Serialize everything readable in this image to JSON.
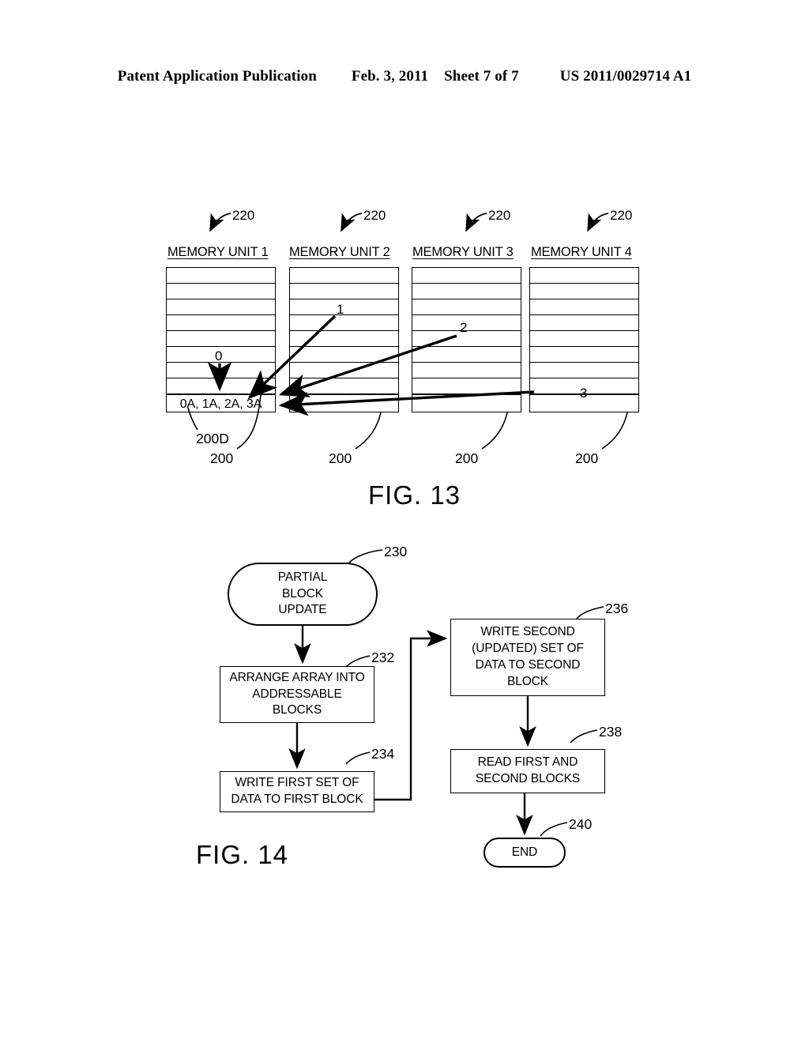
{
  "header": {
    "publication": "Patent Application Publication",
    "date": "Feb. 3, 2011",
    "sheet": "Sheet 7 of 7",
    "number": "US 2011/0029714 A1"
  },
  "figures": [
    {
      "caption": "FIG. 13",
      "unit_ref_label": "220",
      "block_ref_label": "200",
      "data_block_ref_label": "200D",
      "memory_units": [
        {
          "title": "MEMORY UNIT 1",
          "ref": "220",
          "block_ref": "200",
          "rows": 8,
          "data_row_text": "0A, 1A, 2A, 3A",
          "stream_label": "0"
        },
        {
          "title": "MEMORY UNIT 2",
          "ref": "220",
          "block_ref": "200",
          "rows": 8,
          "data_row_text": "",
          "stream_label": "1"
        },
        {
          "title": "MEMORY UNIT 3",
          "ref": "220",
          "block_ref": "200",
          "rows": 8,
          "data_row_text": "",
          "stream_label": "2"
        },
        {
          "title": "MEMORY UNIT 4",
          "ref": "220",
          "block_ref": "200",
          "rows": 8,
          "data_row_text": "",
          "stream_label": "3"
        }
      ]
    },
    {
      "caption": "FIG. 14",
      "nodes": [
        {
          "id": "start",
          "ref": "230",
          "shape": "terminal",
          "text": "PARTIAL\nBLOCK\nUPDATE"
        },
        {
          "id": "arrange",
          "ref": "232",
          "shape": "process",
          "text": "ARRANGE ARRAY INTO\nADDRESSABLE\nBLOCKS"
        },
        {
          "id": "write1",
          "ref": "234",
          "shape": "process",
          "text": "WRITE FIRST SET OF\nDATA TO FIRST BLOCK"
        },
        {
          "id": "write2",
          "ref": "236",
          "shape": "process",
          "text": "WRITE SECOND\n(UPDATED) SET OF\nDATA TO SECOND\nBLOCK"
        },
        {
          "id": "read",
          "ref": "238",
          "shape": "process",
          "text": "READ FIRST AND\nSECOND BLOCKS"
        },
        {
          "id": "end",
          "ref": "240",
          "shape": "terminal",
          "text": "END"
        }
      ]
    }
  ]
}
